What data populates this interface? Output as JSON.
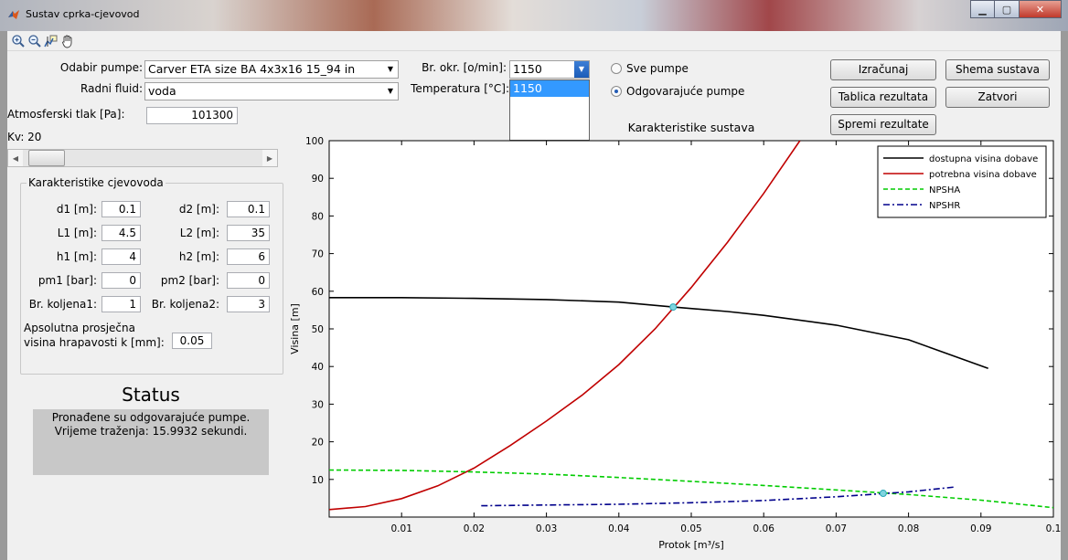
{
  "window": {
    "title": "Sustav cprka-cjevovod"
  },
  "toolbar": {
    "icons": [
      "zoom-in-icon",
      "zoom-out-icon",
      "data-cursor-icon",
      "pan-hand-icon"
    ]
  },
  "form": {
    "pump_label": "Odabir pumpe:",
    "pump_value": "Carver ETA size BA 4x3x16 15_94 in",
    "fluid_label": "Radni fluid:",
    "fluid_value": "voda",
    "atm_label": "Atmosferski tlak [Pa]:",
    "atm_value": "101300",
    "kv_label": "Kv: 20",
    "rpm_label": "Br. okr. [o/min]:",
    "rpm_value": "1150",
    "rpm_option": "1150",
    "temp_label": "Temperatura [°C]:"
  },
  "radios": {
    "all_pumps": "Sve pumpe",
    "matching_pumps": "Odgovarajuće pumpe"
  },
  "buttons": {
    "calculate": "Izračunaj",
    "scheme": "Shema sustava",
    "results_table": "Tablica rezultata",
    "close": "Zatvori",
    "save": "Spremi rezultate"
  },
  "pipeline": {
    "title": "Karakteristike cjevovoda",
    "d1_label": "d1 [m]:",
    "d1": "0.1",
    "d2_label": "d2 [m]:",
    "d2": "0.1",
    "L1_label": "L1 [m]:",
    "L1": "4.5",
    "L2_label": "L2 [m]:",
    "L2": "35",
    "h1_label": "h1 [m]:",
    "h1": "4",
    "h2_label": "h2 [m]:",
    "h2": "6",
    "pm1_label": "pm1 [bar]:",
    "pm1": "0",
    "pm2_label": "pm2 [bar]:",
    "pm2": "0",
    "bends1_label": "Br. koljena1:",
    "bends1": "1",
    "bends2_label": "Br. koljena2:",
    "bends2": "3",
    "rough_label_1": "Apsolutna prosječna",
    "rough_label_2": "visina hrapavosti k [mm]:",
    "rough": "0.05"
  },
  "status": {
    "title": "Status",
    "line1": "Pronađene su odgovarajuće pumpe.",
    "line2": "Vrijeme traženja: 15.9932 sekundi."
  },
  "chart_data": {
    "type": "line",
    "title": "Karakteristike sustava",
    "xlabel": "Protok [m³/s]",
    "ylabel": "Visina [m]",
    "xlim": [
      0,
      0.1
    ],
    "ylim": [
      0,
      100
    ],
    "xticks": [
      0.01,
      0.02,
      0.03,
      0.04,
      0.05,
      0.06,
      0.07,
      0.08,
      0.09,
      0.1
    ],
    "xtick_labels": [
      "0.01",
      "0.02",
      "0.03",
      "0.04",
      "0.05",
      "0.06",
      "0.07",
      "0.08",
      "0.09",
      "0.1"
    ],
    "yticks": [
      10,
      20,
      30,
      40,
      50,
      60,
      70,
      80,
      90,
      100
    ],
    "ytick_labels": [
      "10",
      "20",
      "30",
      "40",
      "50",
      "60",
      "70",
      "80",
      "90",
      "100"
    ],
    "legend_position": "top-right",
    "series": [
      {
        "name": "dostupna visina dobave",
        "color": "#000000",
        "dash": "solid",
        "x": [
          0,
          0.01,
          0.02,
          0.03,
          0.04,
          0.0475,
          0.055,
          0.06,
          0.07,
          0.08,
          0.091
        ],
        "y": [
          58.3,
          58.3,
          58.1,
          57.8,
          57.1,
          55.8,
          54.6,
          53.6,
          51.0,
          47.1,
          39.5
        ]
      },
      {
        "name": "potrebna visina dobave",
        "color": "#c00000",
        "dash": "solid",
        "x": [
          0,
          0.005,
          0.01,
          0.015,
          0.02,
          0.025,
          0.03,
          0.035,
          0.04,
          0.045,
          0.05,
          0.055,
          0.06,
          0.065
        ],
        "y": [
          2.0,
          2.8,
          4.9,
          8.3,
          13.0,
          19.0,
          25.5,
          32.5,
          40.5,
          50.0,
          61.0,
          73.0,
          86.0,
          100.0
        ]
      },
      {
        "name": "NPSHA",
        "color": "#00cc00",
        "dash": "dashed",
        "x": [
          0,
          0.01,
          0.02,
          0.03,
          0.04,
          0.05,
          0.06,
          0.07,
          0.08,
          0.09,
          0.1
        ],
        "y": [
          12.5,
          12.4,
          12.0,
          11.4,
          10.5,
          9.5,
          8.4,
          7.2,
          6.0,
          4.5,
          2.5
        ]
      },
      {
        "name": "NPSHR",
        "color": "#00008b",
        "dash": "dashdot",
        "x": [
          0.021,
          0.03,
          0.04,
          0.05,
          0.06,
          0.07,
          0.08,
          0.0865
        ],
        "y": [
          3.0,
          3.2,
          3.4,
          3.8,
          4.4,
          5.4,
          6.7,
          8.0
        ]
      }
    ],
    "markers": [
      {
        "x": 0.0475,
        "y": 55.8
      },
      {
        "x": 0.0765,
        "y": 6.3
      }
    ]
  }
}
